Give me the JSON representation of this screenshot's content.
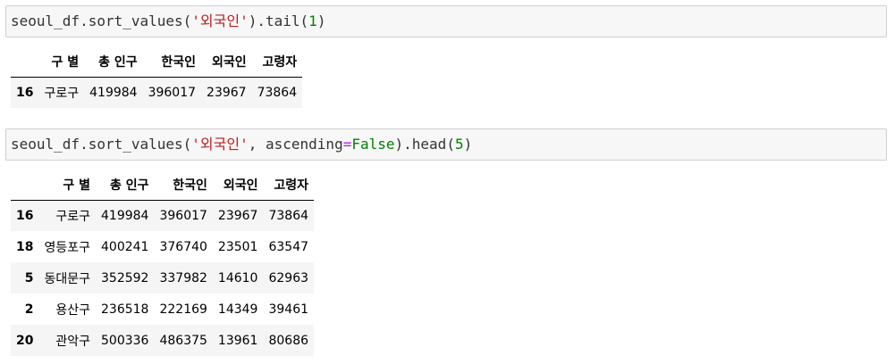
{
  "cells": [
    {
      "code_parts": [
        {
          "t": "seoul_df.sort_values(",
          "c": ""
        },
        {
          "t": "'외국인'",
          "c": "tok-str"
        },
        {
          "t": ").tail(",
          "c": ""
        },
        {
          "t": "1",
          "c": "tok-num"
        },
        {
          "t": ")",
          "c": ""
        }
      ],
      "table": {
        "columns": [
          "",
          "구 별",
          "총 인구",
          "한국인",
          "외국인",
          "고령자"
        ],
        "rows": [
          [
            "16",
            "구로구",
            "419984",
            "396017",
            "23967",
            "73864"
          ]
        ]
      }
    },
    {
      "code_parts": [
        {
          "t": "seoul_df.sort_values(",
          "c": ""
        },
        {
          "t": "'외국인'",
          "c": "tok-str"
        },
        {
          "t": ", ascending",
          "c": ""
        },
        {
          "t": "=",
          "c": "tok-op"
        },
        {
          "t": "False",
          "c": "tok-kw"
        },
        {
          "t": ").head(",
          "c": ""
        },
        {
          "t": "5",
          "c": "tok-num"
        },
        {
          "t": ")",
          "c": ""
        }
      ],
      "table": {
        "columns": [
          "",
          "구 별",
          "총 인구",
          "한국인",
          "외국인",
          "고령자"
        ],
        "rows": [
          [
            "16",
            "구로구",
            "419984",
            "396017",
            "23967",
            "73864"
          ],
          [
            "18",
            "영등포구",
            "400241",
            "376740",
            "23501",
            "63547"
          ],
          [
            "5",
            "동대문구",
            "352592",
            "337982",
            "14610",
            "62963"
          ],
          [
            "2",
            "용산구",
            "236518",
            "222169",
            "14349",
            "39461"
          ],
          [
            "20",
            "관악구",
            "500336",
            "486375",
            "13961",
            "80686"
          ]
        ]
      }
    }
  ],
  "colors": {
    "string": "#ba2121",
    "keyword": "#008000",
    "operator": "#aa22ff",
    "cell_bg": "#f7f7f7",
    "row_stripe": "#f5f5f5"
  }
}
